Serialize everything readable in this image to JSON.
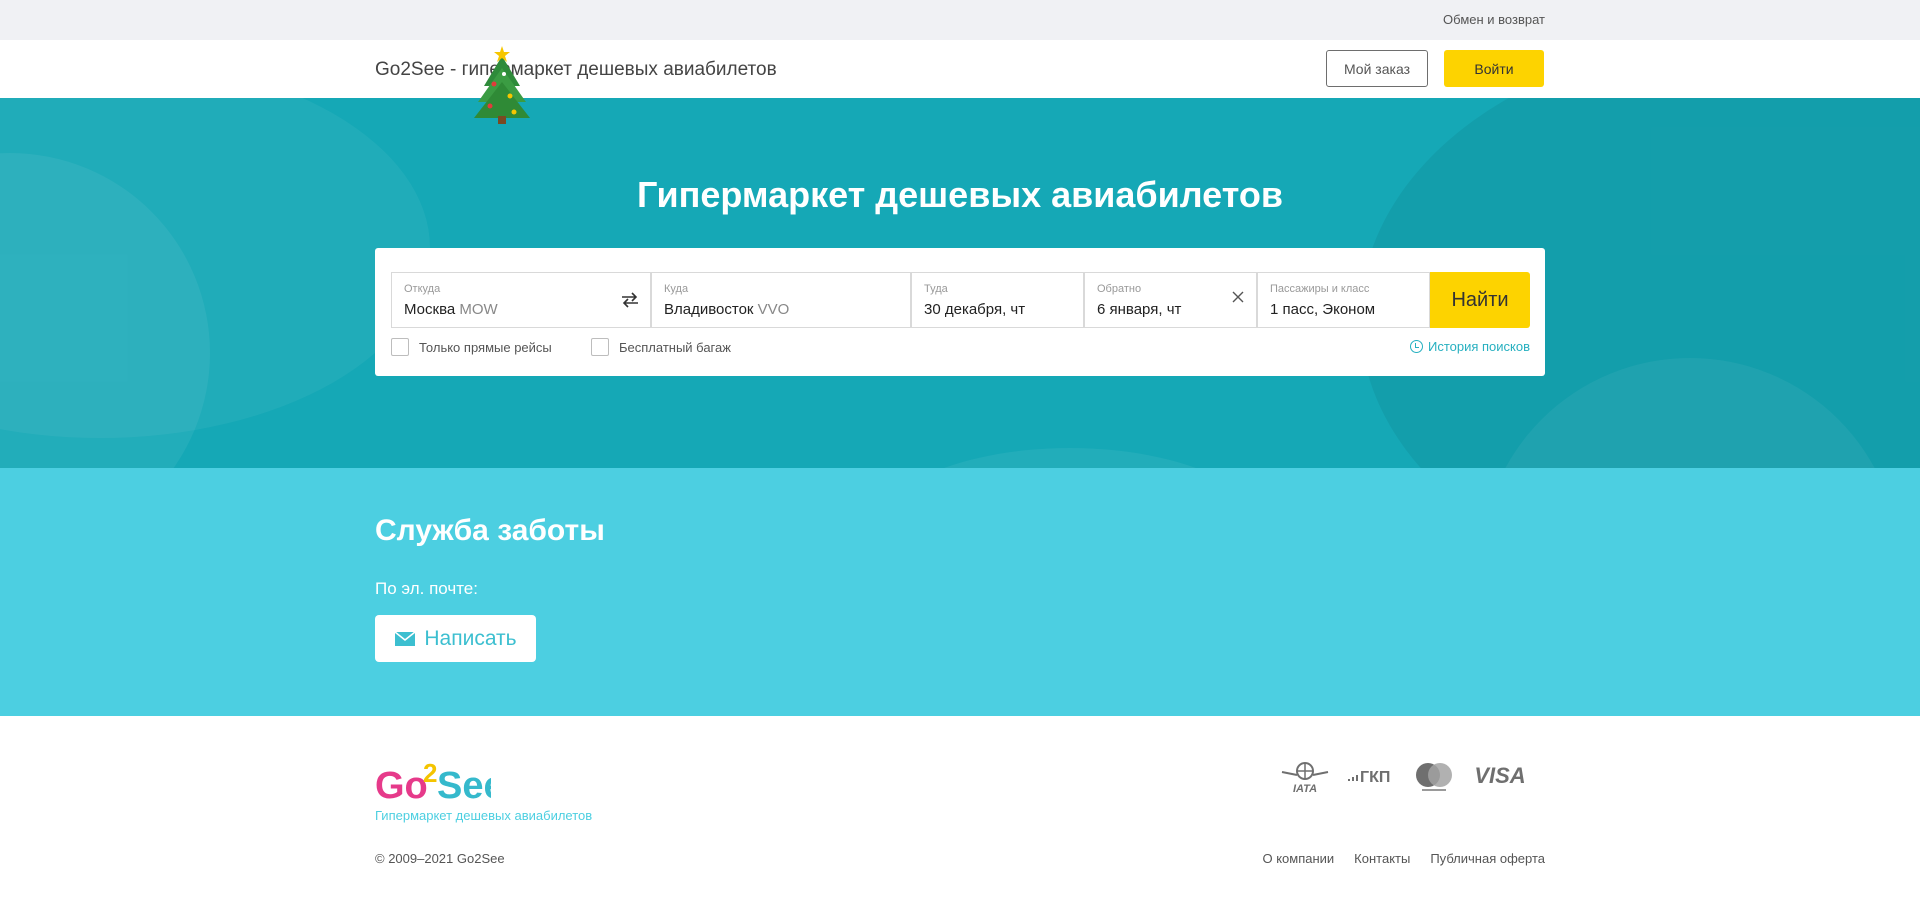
{
  "topbar": {
    "exchange_link": "Обмен и возврат"
  },
  "header": {
    "logo_alt": "Go2See - гипермаркет дешевых авиабилетов",
    "order_button": "Мой заказ",
    "login_button": "Войти"
  },
  "hero": {
    "title": "Гипермаркет дешевых авиабилетов"
  },
  "search": {
    "from": {
      "label": "Откуда",
      "city": "Москва",
      "code": "MOW"
    },
    "to": {
      "label": "Куда",
      "city": "Владивосток",
      "code": "VVO"
    },
    "depart": {
      "label": "Туда",
      "value": "30 декабря, чт"
    },
    "return": {
      "label": "Обратно",
      "value": "6 января, чт"
    },
    "passengers": {
      "label": "Пассажиры и класс",
      "value": "1 пасс, Эконом"
    },
    "find_button": "Найти",
    "direct_only": "Только прямые рейсы",
    "free_baggage": "Бесплатный багаж",
    "history": "История поисков"
  },
  "care": {
    "title": "Служба заботы",
    "email_label": "По эл. почте:",
    "write_button": "Написать"
  },
  "footer": {
    "tagline": "Гипермаркет дешевых авиабилетов",
    "copyright": "© 2009–2021 Go2See",
    "links": [
      "О компании",
      "Контакты",
      "Публичная оферта"
    ]
  },
  "colors": {
    "accent": "#fdd300",
    "teal": "#15a8b6",
    "light_teal": "#4ccfe1"
  }
}
